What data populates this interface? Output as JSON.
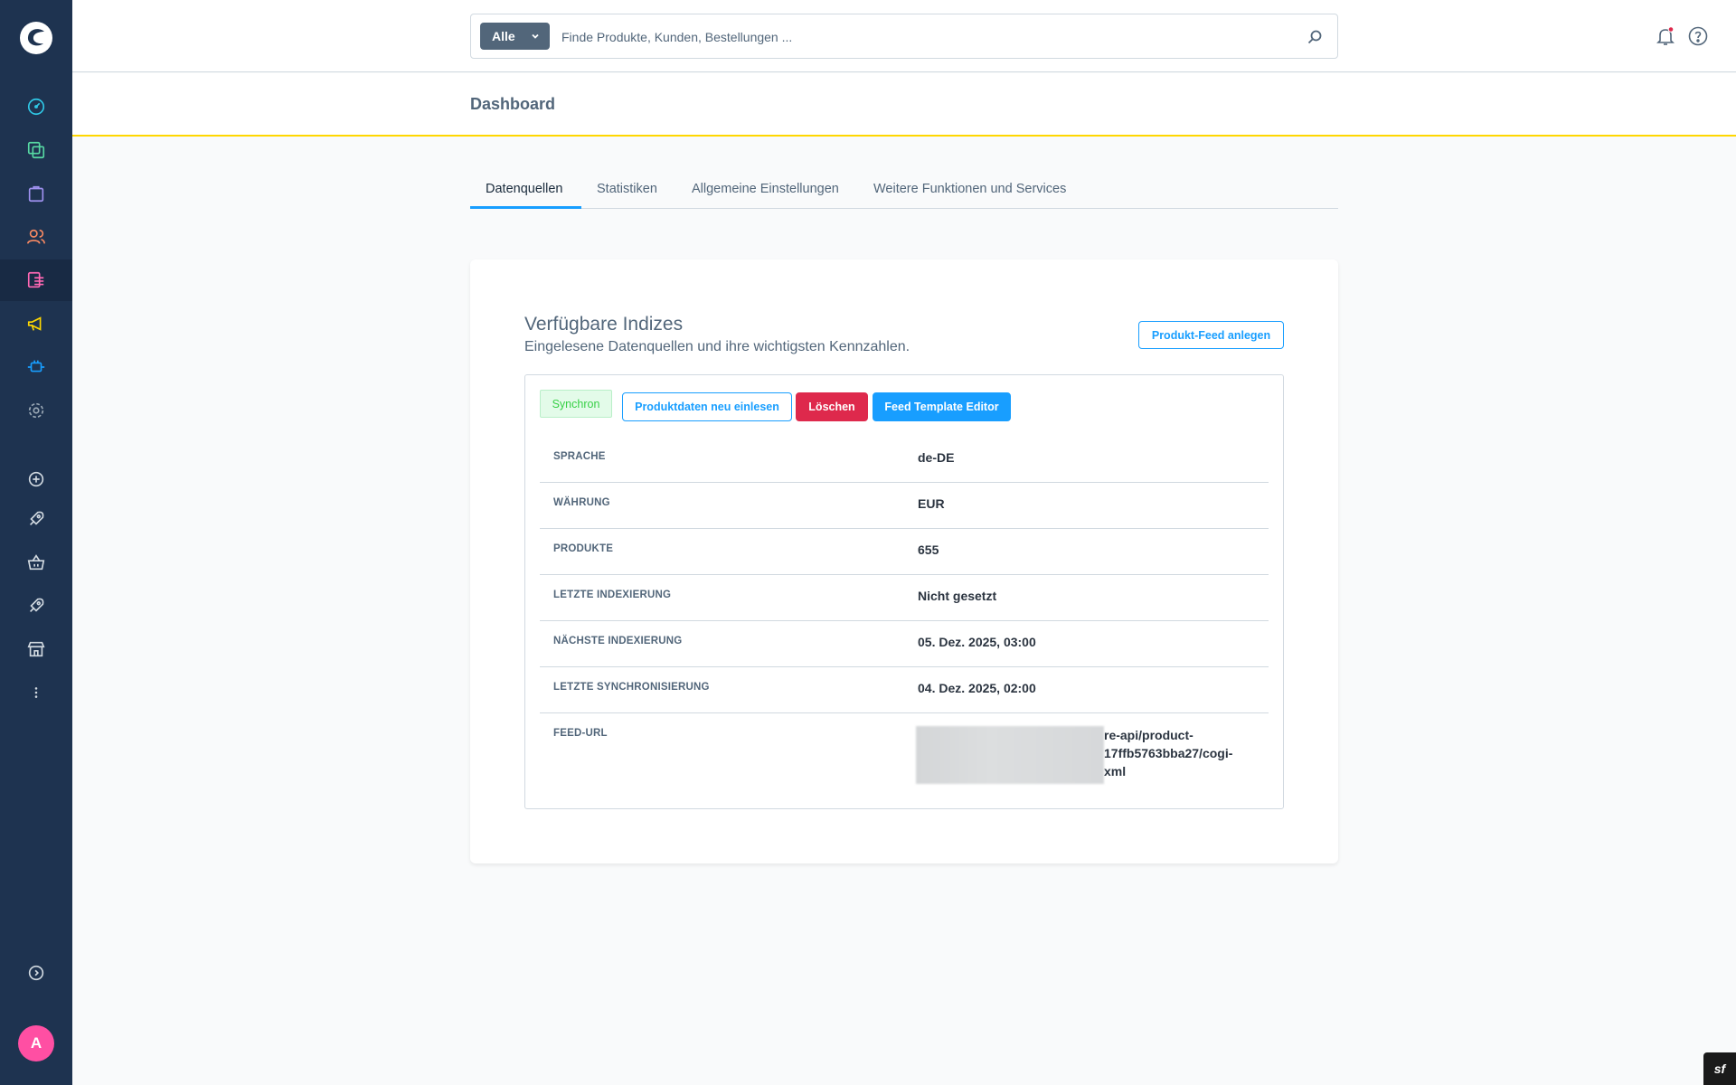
{
  "header": {
    "search_type": "Alle",
    "search_placeholder": "Finde Produkte, Kunden, Bestellungen ...",
    "page_title": "Dashboard"
  },
  "user": {
    "initial": "A"
  },
  "tabs": [
    {
      "label": "Datenquellen",
      "active": true
    },
    {
      "label": "Statistiken",
      "active": false
    },
    {
      "label": "Allgemeine Einstellungen",
      "active": false
    },
    {
      "label": "Weitere Funktionen und Services",
      "active": false
    }
  ],
  "card": {
    "title": "Verfügbare Indizes",
    "subtitle": "Eingelesene Datenquellen und ihre wichtigsten Kennzahlen.",
    "create_feed_button": "Produkt-Feed anlegen",
    "status_badge": "Synchron",
    "reload_button": "Produktdaten neu einlesen",
    "delete_button": "Löschen",
    "template_editor_button": "Feed Template Editor",
    "rows": [
      {
        "label": "SPRACHE",
        "value": "de-DE"
      },
      {
        "label": "WÄHRUNG",
        "value": "EUR"
      },
      {
        "label": "PRODUKTE",
        "value": "655"
      },
      {
        "label": "LETZTE INDEXIERUNG",
        "value": "Nicht gesetzt"
      },
      {
        "label": "NÄCHSTE INDEXIERUNG",
        "value": "05. Dez. 2025, 03:00"
      },
      {
        "label": "LETZTE SYNCHRONISIERUNG",
        "value": "04. Dez. 2025, 02:00"
      },
      {
        "label": "FEED-URL",
        "value": "re-api/product-\n17ffb5763bba27/cogi-\nxml"
      }
    ]
  },
  "colors": {
    "sidebar_bg": "#1e3350",
    "accent": "#189eff",
    "danger": "#de294c",
    "success": "#37d046",
    "smartbar_border": "#ffd700",
    "avatar": "#ff4fa3"
  },
  "icons": {
    "sidebar": [
      "dashboard-icon",
      "catalog-icon",
      "orders-icon",
      "customers-icon",
      "content-icon",
      "marketing-icon",
      "extensions-icon",
      "settings-icon",
      "add-icon",
      "rocket-icon",
      "basket-icon",
      "rocket-icon",
      "store-icon",
      "more-icon",
      "collapse-icon"
    ],
    "header": [
      "search-icon",
      "bell-icon",
      "help-icon"
    ]
  }
}
